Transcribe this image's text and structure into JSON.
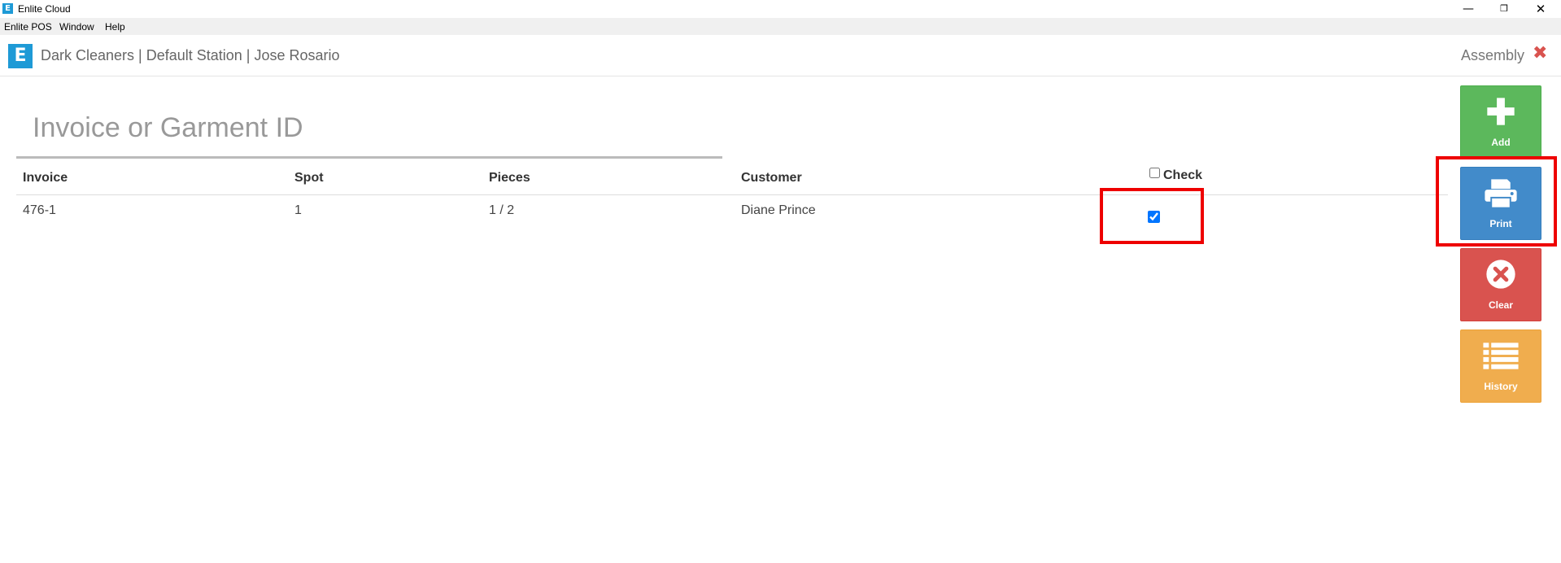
{
  "window": {
    "title": "Enlite Cloud",
    "icon_letter": "E",
    "minimize_glyph": "—",
    "maximize_glyph": "❐",
    "close_glyph": "✕"
  },
  "menu": {
    "items": [
      "Enlite POS",
      "Window",
      "Help"
    ]
  },
  "header": {
    "logo_letter": "E",
    "title": "Dark Cleaners | Default Station | Jose Rosario",
    "module": "Assembly",
    "close_glyph": "✖"
  },
  "search": {
    "placeholder": "Invoice or Garment ID",
    "value": ""
  },
  "table": {
    "columns": {
      "invoice": "Invoice",
      "spot": "Spot",
      "pieces": "Pieces",
      "customer": "Customer",
      "check": "Check"
    },
    "check_all_checked": false,
    "rows": [
      {
        "invoice": "476-1",
        "spot": "1",
        "pieces": "1 / 2",
        "customer": "Diane Prince",
        "checked": true
      }
    ]
  },
  "actions": {
    "add": "Add",
    "print": "Print",
    "clear": "Clear",
    "history": "History"
  },
  "colors": {
    "brand": "#1e9ad6",
    "add": "#5cb85c",
    "print": "#428bca",
    "clear": "#d9534f",
    "history": "#f0ad4e",
    "highlight": "#ee0000"
  }
}
